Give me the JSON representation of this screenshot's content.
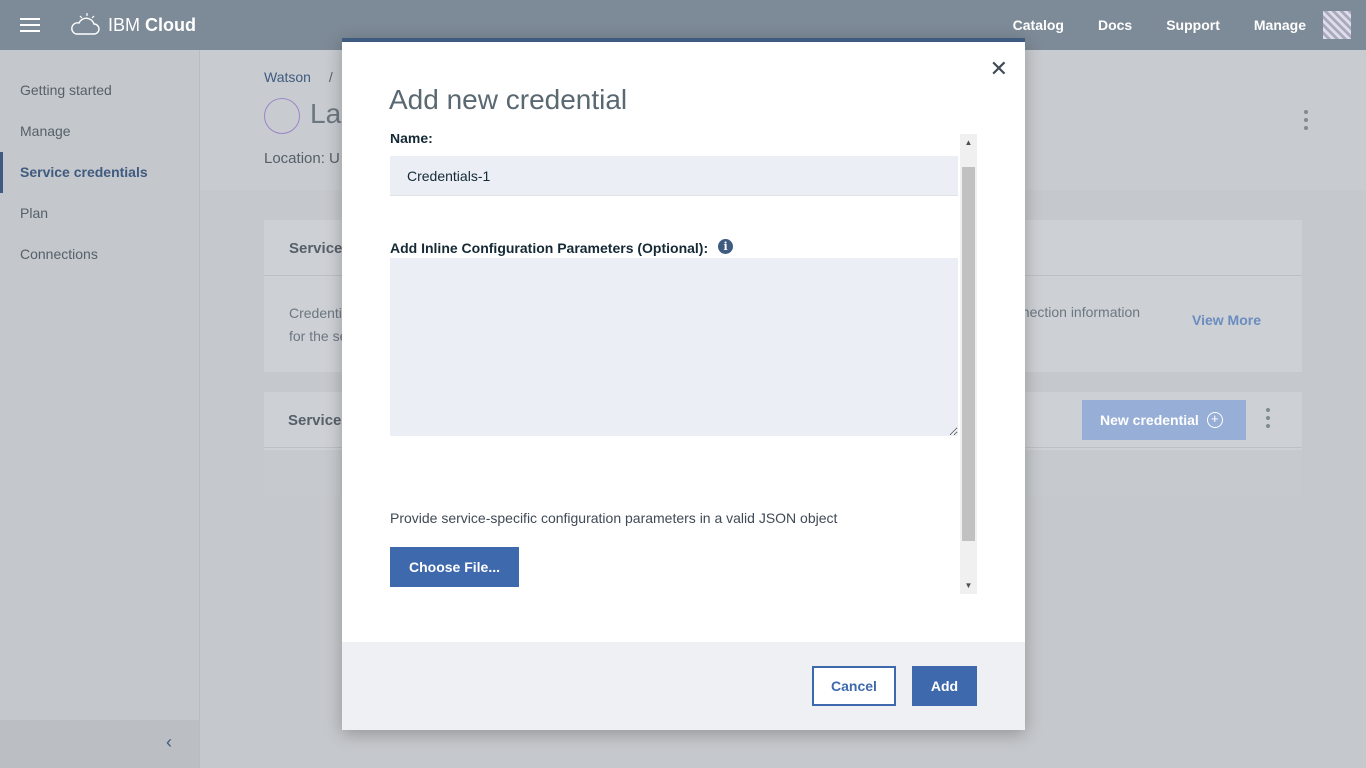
{
  "topbar": {
    "brand_light": "IBM",
    "brand_bold": "Cloud",
    "nav": [
      "Catalog",
      "Docs",
      "Support",
      "Manage"
    ]
  },
  "sidebar": {
    "items": [
      {
        "label": "Getting started"
      },
      {
        "label": "Manage"
      },
      {
        "label": "Service credentials",
        "active": true
      },
      {
        "label": "Plan"
      },
      {
        "label": "Connections"
      }
    ],
    "collapse_icon": "chevron-left-icon"
  },
  "page": {
    "breadcrumb": [
      "Watson",
      "/"
    ],
    "title_partial": "La",
    "location_partial": "Location: U",
    "card1": {
      "heading_partial": "Service",
      "body_line1_partial": "Credenti",
      "body_line2_partial": "for the se",
      "body_right_partial": "nnection information",
      "view_more": "View More"
    },
    "card2": {
      "heading_partial": "Service c",
      "new_credential_label": "New credential"
    }
  },
  "modal": {
    "title": "Add new credential",
    "name_label": "Name:",
    "name_value": "Credentials-1",
    "inline_label": "Add Inline Configuration Parameters (Optional):",
    "info_glyph": "i",
    "inline_value": "",
    "helper_text": "Provide service-specific configuration parameters in a valid JSON object",
    "choose_file_label": "Choose File...",
    "cancel_label": "Cancel",
    "add_label": "Add",
    "close_glyph": "✕"
  },
  "colors": {
    "accent": "#3f69ad",
    "modal_top_border": "#3f5b80",
    "input_bg": "#ebeef5"
  }
}
